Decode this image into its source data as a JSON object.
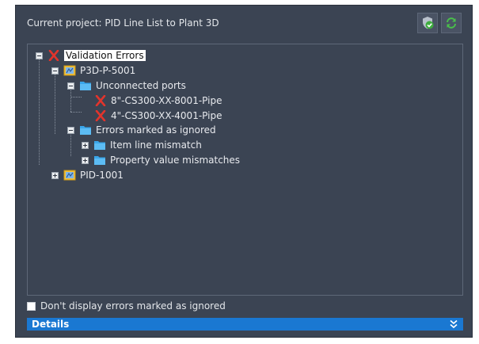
{
  "header": {
    "project_label": "Current project: PID Line List to Plant 3D"
  },
  "toolbar": {
    "validate_icon": "validate-check-icon",
    "refresh_icon": "refresh-icon"
  },
  "tree": {
    "root": "Validation Errors",
    "drawing1": "P3D-P-5001",
    "unconnected": "Unconnected ports",
    "pipe1": "8\"-CS300-XX-8001-Pipe",
    "pipe2": "4\"-CS300-XX-4001-Pipe",
    "ignored": "Errors marked as ignored",
    "item_line": "Item line mismatch",
    "prop_value": "Property value mismatches",
    "drawing2": "PID-1001"
  },
  "footer": {
    "checkbox_label": "Don't display errors marked as ignored",
    "details_label": "Details"
  },
  "colors": {
    "panel_bg": "#3b4453",
    "accent": "#1a78d2",
    "error_red": "#e2342c"
  }
}
